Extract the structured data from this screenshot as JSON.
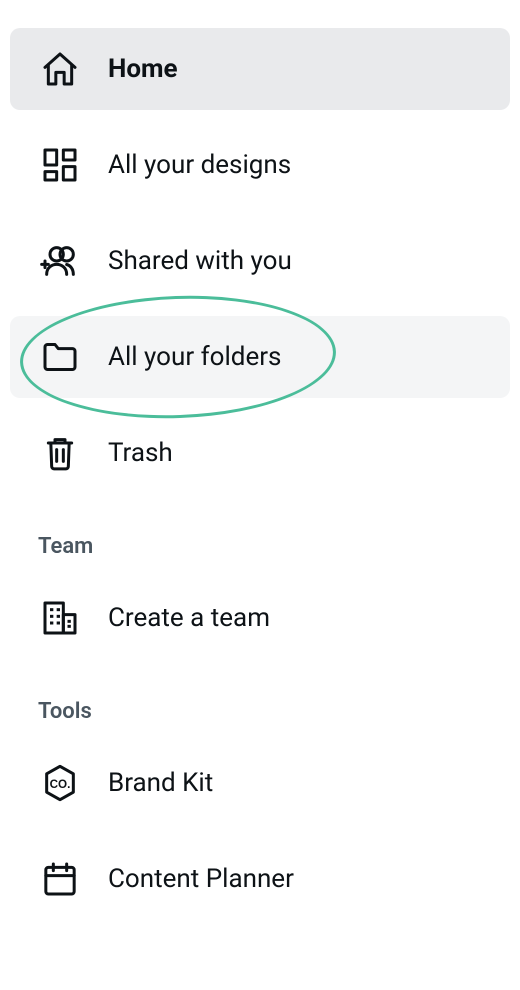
{
  "colors": {
    "annotation": "#4bbd9a"
  },
  "primary_group": {
    "items": [
      {
        "id": "home",
        "icon": "home-icon",
        "label": "Home",
        "state": "active"
      },
      {
        "id": "all-designs",
        "icon": "grid-icon",
        "label": "All your designs",
        "state": "normal"
      },
      {
        "id": "shared",
        "icon": "people-plus-icon",
        "label": "Shared with you",
        "state": "normal"
      },
      {
        "id": "all-folders",
        "icon": "folder-icon",
        "label": "All your folders",
        "state": "hover",
        "annotated": true
      },
      {
        "id": "trash",
        "icon": "trash-icon",
        "label": "Trash",
        "state": "normal"
      }
    ]
  },
  "team_group": {
    "header": "Team",
    "items": [
      {
        "id": "create-team",
        "icon": "buildings-icon",
        "label": "Create a team",
        "state": "normal"
      }
    ]
  },
  "tools_group": {
    "header": "Tools",
    "items": [
      {
        "id": "brand-kit",
        "icon": "company-badge-icon",
        "label": "Brand Kit",
        "state": "normal"
      },
      {
        "id": "content-planner",
        "icon": "calendar-icon",
        "label": "Content Planner",
        "state": "normal"
      }
    ]
  }
}
